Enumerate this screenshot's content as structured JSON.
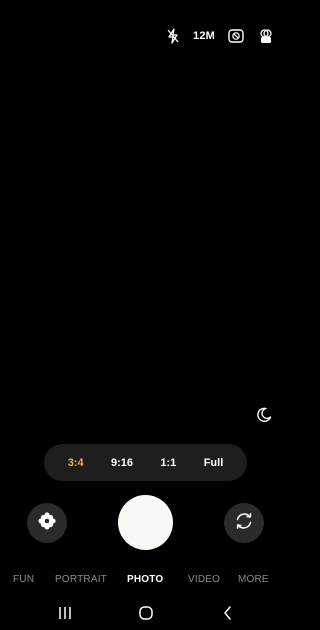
{
  "top_bar": {
    "flash_icon": "flash-off-icon",
    "resolution": "12M",
    "motion_icon": "motion-photo-icon",
    "filter_icon": "filter-icon"
  },
  "night_icon": "moon-icon",
  "aspect_ratios": {
    "options": [
      "3:4",
      "9:16",
      "1:1",
      "Full"
    ],
    "selected": "3:4",
    "accent_color": "#f0b429"
  },
  "controls": {
    "effects_icon": "flower-icon",
    "shutter_icon": "shutter-button",
    "switch_icon": "switch-camera-icon"
  },
  "modes": {
    "items": [
      "FUN",
      "PORTRAIT",
      "PHOTO",
      "VIDEO",
      "MORE"
    ],
    "selected": "PHOTO"
  },
  "nav": {
    "recents_icon": "recents-icon",
    "home_icon": "home-icon",
    "back_icon": "back-icon"
  }
}
